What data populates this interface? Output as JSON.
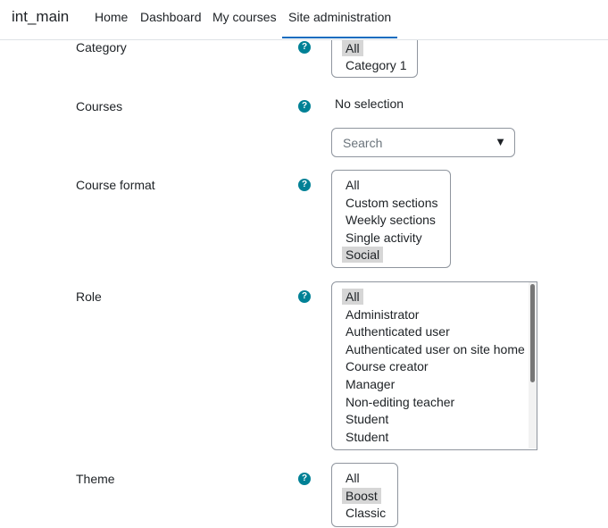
{
  "navbar": {
    "brand": "int_main",
    "items": [
      {
        "label": "Home"
      },
      {
        "label": "Dashboard"
      },
      {
        "label": "My courses"
      },
      {
        "label": "Site administration",
        "active": true
      }
    ]
  },
  "help_icon_glyph": "?",
  "fields": {
    "category": {
      "label": "Category",
      "options": [
        "All",
        "Category 1"
      ],
      "selected": "All"
    },
    "courses": {
      "label": "Courses",
      "no_selection": "No selection",
      "search_placeholder": "Search",
      "dropdown_icon": "caret-down-icon"
    },
    "course_format": {
      "label": "Course format",
      "options": [
        "All",
        "Custom sections",
        "Weekly sections",
        "Single activity",
        "Social"
      ],
      "selected": "Social"
    },
    "role": {
      "label": "Role",
      "options": [
        "All",
        "Administrator",
        "Authenticated user",
        "Authenticated user on site home",
        "Course creator",
        "Manager",
        "Non-editing teacher",
        "Student",
        "Student"
      ],
      "selected": "All"
    },
    "theme": {
      "label": "Theme",
      "options": [
        "All",
        "Boost",
        "Classic"
      ],
      "selected": "Boost"
    }
  },
  "colors": {
    "help_icon": "#008196",
    "active_tab_underline": "#0f6cbf",
    "selected_option_bg": "#d6d6d6"
  }
}
